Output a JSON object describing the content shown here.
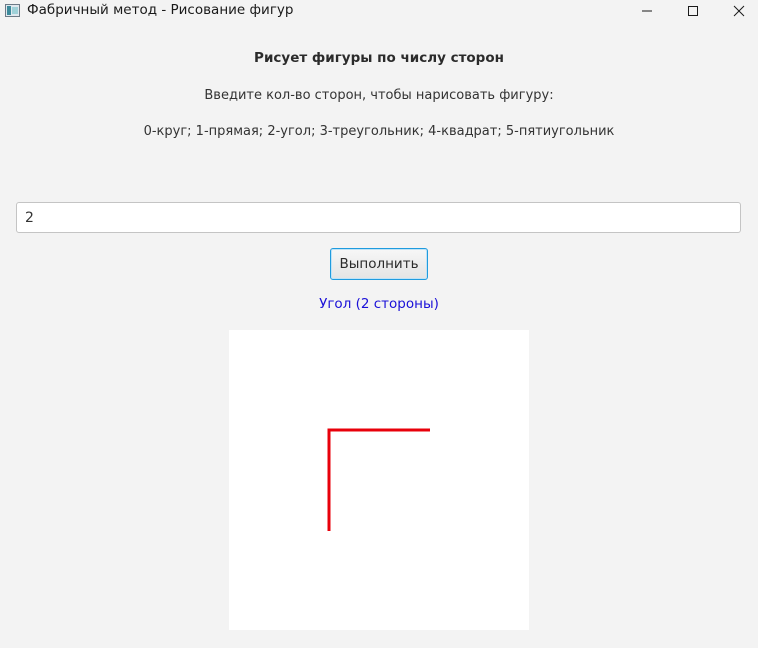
{
  "window": {
    "title": "Фабричный метод - Рисование фигур",
    "controls": [
      "minimize-icon",
      "maximize-icon",
      "close-icon"
    ]
  },
  "main": {
    "heading": "Рисует фигуры по числу сторон",
    "prompt": "Введите кол-во сторон, чтобы нарисовать фигуру:",
    "legend": "0-круг; 1-прямая; 2-угол; 3-треугольник; 4-квадрат; 5-пятиугольник",
    "input_value": "2",
    "button_label": "Выполнить",
    "result_text": "Угол (2 стороны)",
    "result_color": "#1a10d8"
  },
  "drawing": {
    "shape": "angle",
    "sides": 2,
    "stroke_color": "#e8000b",
    "background": "#ffffff"
  }
}
